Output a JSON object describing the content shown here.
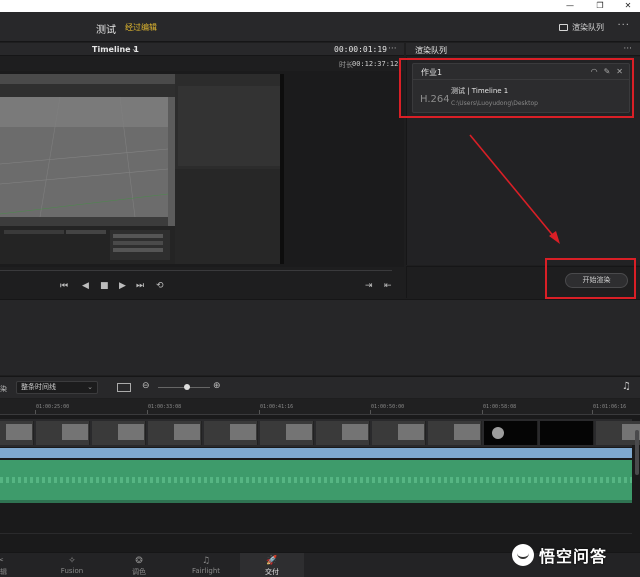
{
  "window": {
    "minimize_glyph": "—",
    "restore_glyph": "❐",
    "close_glyph": "✕"
  },
  "topbar": {
    "project_name": "测试",
    "project_status": "经过编辑",
    "render_queue_label": "渲染队列",
    "dots": "···"
  },
  "viewer": {
    "timeline_name": "Timeline 1",
    "timecode": "00:00:01:19",
    "dots": "···",
    "duration_label": "时长",
    "duration_value": "00:12:37:12"
  },
  "transport": {
    "first": "⏮",
    "prev": "◀",
    "stop": "■",
    "play": "▶",
    "last": "⏭",
    "loop": "⟲",
    "in": "⇥",
    "out": "⇤"
  },
  "render_queue": {
    "title": "渲染队列",
    "dots": "···",
    "job": {
      "name": "作业1",
      "codec": "H.264",
      "timeline": "测试 | Timeline 1",
      "path": "C:\\Users\\Luoyudong\\Desktop"
    },
    "start_button": "开始渲染"
  },
  "timeline_toolbar": {
    "left_text": "染",
    "select_value": "整条时间线",
    "minus": "⊖",
    "plus": "⊕",
    "music": "♫"
  },
  "ruler": {
    "ticks": [
      "01:00:25:00",
      "01:00:33:08",
      "01:00:41:16",
      "01:00:50:00",
      "01:00:58:08",
      "01:01:06:16"
    ]
  },
  "pages": [
    {
      "icon": "✂",
      "label": "剪辑"
    },
    {
      "icon": "✧",
      "label": "Fusion"
    },
    {
      "icon": "❂",
      "label": "调色"
    },
    {
      "icon": "♫",
      "label": "Fairlight"
    },
    {
      "icon": "🚀",
      "label": "交付"
    }
  ],
  "watermark": {
    "text": "悟空问答"
  },
  "colors": {
    "accent_red": "#d91f26",
    "status_yellow": "#e0b72f",
    "audio_green": "#3e9b6b",
    "video_blue": "#7fa9cf"
  }
}
